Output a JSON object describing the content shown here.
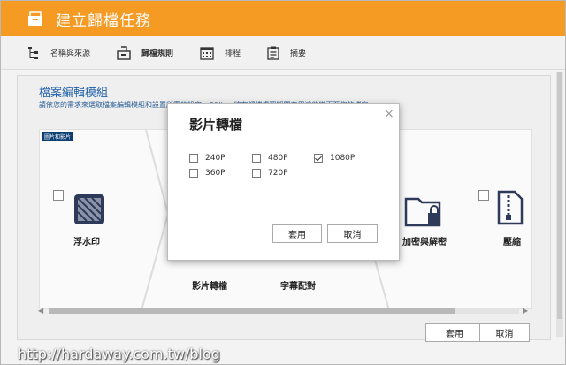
{
  "window": {
    "title": "建立歸檔任務"
  },
  "steps": [
    {
      "label": "名稱與來源",
      "icon": "source-tree-icon"
    },
    {
      "label": "歸檔規則",
      "icon": "archive-rule-icon"
    },
    {
      "label": "排程",
      "icon": "calendar-icon"
    },
    {
      "label": "摘要",
      "icon": "summary-icon"
    }
  ],
  "main": {
    "section_title": "檔案編輯模組",
    "section_desc": "請依您的需求來選取檔案編輯模組和設置所需的設定。Qfiling 將在歸檔處理期間套用這些變更至您的檔案。",
    "tags": [
      "圖片和影片",
      "",
      "",
      ""
    ],
    "modules": [
      {
        "label": "浮水印",
        "icon": "watermark-icon"
      },
      {
        "label": "影片轉檔",
        "icon": "video-convert-icon"
      },
      {
        "label": "字幕配對",
        "icon": "subtitle-icon"
      },
      {
        "label": "加密與解密",
        "icon": "folder-lock-icon"
      },
      {
        "label": "壓縮",
        "icon": "zip-file-icon"
      }
    ],
    "apply_button": "套用",
    "cancel_button": "取消"
  },
  "modal": {
    "title": "影片轉檔",
    "close": "×",
    "options": [
      {
        "label": "240P",
        "checked": false
      },
      {
        "label": "480P",
        "checked": false
      },
      {
        "label": "1080P",
        "checked": true
      },
      {
        "label": "360P",
        "checked": false
      },
      {
        "label": "720P",
        "checked": false
      }
    ],
    "apply_button": "套用",
    "cancel_button": "取消"
  },
  "watermark_text": "http://hardaway.com.tw/blog",
  "colors": {
    "accent": "#f59a23",
    "title_blue": "#1e5fa8",
    "tag_navy": "#0b3e73",
    "icon_navy": "#2e3a5a"
  }
}
